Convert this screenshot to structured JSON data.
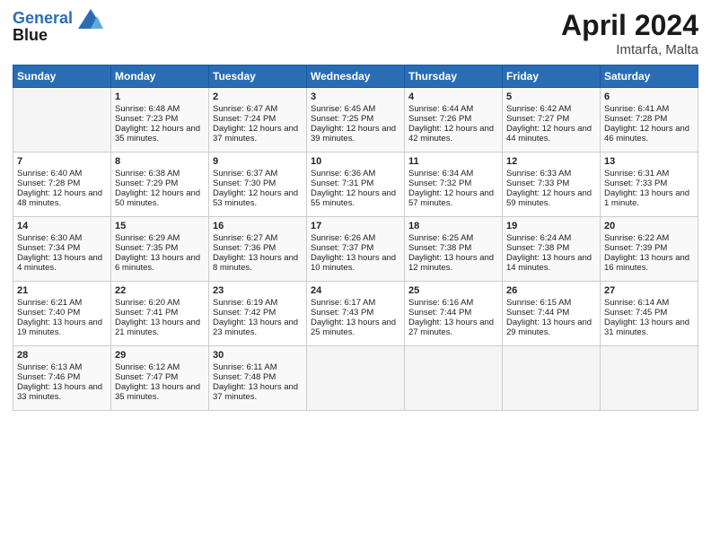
{
  "header": {
    "logo_line1": "General",
    "logo_line2": "Blue",
    "month_title": "April 2024",
    "location": "Imtarfa, Malta"
  },
  "days_of_week": [
    "Sunday",
    "Monday",
    "Tuesday",
    "Wednesday",
    "Thursday",
    "Friday",
    "Saturday"
  ],
  "weeks": [
    [
      {
        "day": "",
        "sunrise": "",
        "sunset": "",
        "daylight": ""
      },
      {
        "day": "1",
        "sunrise": "Sunrise: 6:48 AM",
        "sunset": "Sunset: 7:23 PM",
        "daylight": "Daylight: 12 hours and 35 minutes."
      },
      {
        "day": "2",
        "sunrise": "Sunrise: 6:47 AM",
        "sunset": "Sunset: 7:24 PM",
        "daylight": "Daylight: 12 hours and 37 minutes."
      },
      {
        "day": "3",
        "sunrise": "Sunrise: 6:45 AM",
        "sunset": "Sunset: 7:25 PM",
        "daylight": "Daylight: 12 hours and 39 minutes."
      },
      {
        "day": "4",
        "sunrise": "Sunrise: 6:44 AM",
        "sunset": "Sunset: 7:26 PM",
        "daylight": "Daylight: 12 hours and 42 minutes."
      },
      {
        "day": "5",
        "sunrise": "Sunrise: 6:42 AM",
        "sunset": "Sunset: 7:27 PM",
        "daylight": "Daylight: 12 hours and 44 minutes."
      },
      {
        "day": "6",
        "sunrise": "Sunrise: 6:41 AM",
        "sunset": "Sunset: 7:28 PM",
        "daylight": "Daylight: 12 hours and 46 minutes."
      }
    ],
    [
      {
        "day": "7",
        "sunrise": "Sunrise: 6:40 AM",
        "sunset": "Sunset: 7:28 PM",
        "daylight": "Daylight: 12 hours and 48 minutes."
      },
      {
        "day": "8",
        "sunrise": "Sunrise: 6:38 AM",
        "sunset": "Sunset: 7:29 PM",
        "daylight": "Daylight: 12 hours and 50 minutes."
      },
      {
        "day": "9",
        "sunrise": "Sunrise: 6:37 AM",
        "sunset": "Sunset: 7:30 PM",
        "daylight": "Daylight: 12 hours and 53 minutes."
      },
      {
        "day": "10",
        "sunrise": "Sunrise: 6:36 AM",
        "sunset": "Sunset: 7:31 PM",
        "daylight": "Daylight: 12 hours and 55 minutes."
      },
      {
        "day": "11",
        "sunrise": "Sunrise: 6:34 AM",
        "sunset": "Sunset: 7:32 PM",
        "daylight": "Daylight: 12 hours and 57 minutes."
      },
      {
        "day": "12",
        "sunrise": "Sunrise: 6:33 AM",
        "sunset": "Sunset: 7:33 PM",
        "daylight": "Daylight: 12 hours and 59 minutes."
      },
      {
        "day": "13",
        "sunrise": "Sunrise: 6:31 AM",
        "sunset": "Sunset: 7:33 PM",
        "daylight": "Daylight: 13 hours and 1 minute."
      }
    ],
    [
      {
        "day": "14",
        "sunrise": "Sunrise: 6:30 AM",
        "sunset": "Sunset: 7:34 PM",
        "daylight": "Daylight: 13 hours and 4 minutes."
      },
      {
        "day": "15",
        "sunrise": "Sunrise: 6:29 AM",
        "sunset": "Sunset: 7:35 PM",
        "daylight": "Daylight: 13 hours and 6 minutes."
      },
      {
        "day": "16",
        "sunrise": "Sunrise: 6:27 AM",
        "sunset": "Sunset: 7:36 PM",
        "daylight": "Daylight: 13 hours and 8 minutes."
      },
      {
        "day": "17",
        "sunrise": "Sunrise: 6:26 AM",
        "sunset": "Sunset: 7:37 PM",
        "daylight": "Daylight: 13 hours and 10 minutes."
      },
      {
        "day": "18",
        "sunrise": "Sunrise: 6:25 AM",
        "sunset": "Sunset: 7:38 PM",
        "daylight": "Daylight: 13 hours and 12 minutes."
      },
      {
        "day": "19",
        "sunrise": "Sunrise: 6:24 AM",
        "sunset": "Sunset: 7:38 PM",
        "daylight": "Daylight: 13 hours and 14 minutes."
      },
      {
        "day": "20",
        "sunrise": "Sunrise: 6:22 AM",
        "sunset": "Sunset: 7:39 PM",
        "daylight": "Daylight: 13 hours and 16 minutes."
      }
    ],
    [
      {
        "day": "21",
        "sunrise": "Sunrise: 6:21 AM",
        "sunset": "Sunset: 7:40 PM",
        "daylight": "Daylight: 13 hours and 19 minutes."
      },
      {
        "day": "22",
        "sunrise": "Sunrise: 6:20 AM",
        "sunset": "Sunset: 7:41 PM",
        "daylight": "Daylight: 13 hours and 21 minutes."
      },
      {
        "day": "23",
        "sunrise": "Sunrise: 6:19 AM",
        "sunset": "Sunset: 7:42 PM",
        "daylight": "Daylight: 13 hours and 23 minutes."
      },
      {
        "day": "24",
        "sunrise": "Sunrise: 6:17 AM",
        "sunset": "Sunset: 7:43 PM",
        "daylight": "Daylight: 13 hours and 25 minutes."
      },
      {
        "day": "25",
        "sunrise": "Sunrise: 6:16 AM",
        "sunset": "Sunset: 7:44 PM",
        "daylight": "Daylight: 13 hours and 27 minutes."
      },
      {
        "day": "26",
        "sunrise": "Sunrise: 6:15 AM",
        "sunset": "Sunset: 7:44 PM",
        "daylight": "Daylight: 13 hours and 29 minutes."
      },
      {
        "day": "27",
        "sunrise": "Sunrise: 6:14 AM",
        "sunset": "Sunset: 7:45 PM",
        "daylight": "Daylight: 13 hours and 31 minutes."
      }
    ],
    [
      {
        "day": "28",
        "sunrise": "Sunrise: 6:13 AM",
        "sunset": "Sunset: 7:46 PM",
        "daylight": "Daylight: 13 hours and 33 minutes."
      },
      {
        "day": "29",
        "sunrise": "Sunrise: 6:12 AM",
        "sunset": "Sunset: 7:47 PM",
        "daylight": "Daylight: 13 hours and 35 minutes."
      },
      {
        "day": "30",
        "sunrise": "Sunrise: 6:11 AM",
        "sunset": "Sunset: 7:48 PM",
        "daylight": "Daylight: 13 hours and 37 minutes."
      },
      {
        "day": "",
        "sunrise": "",
        "sunset": "",
        "daylight": ""
      },
      {
        "day": "",
        "sunrise": "",
        "sunset": "",
        "daylight": ""
      },
      {
        "day": "",
        "sunrise": "",
        "sunset": "",
        "daylight": ""
      },
      {
        "day": "",
        "sunrise": "",
        "sunset": "",
        "daylight": ""
      }
    ]
  ]
}
